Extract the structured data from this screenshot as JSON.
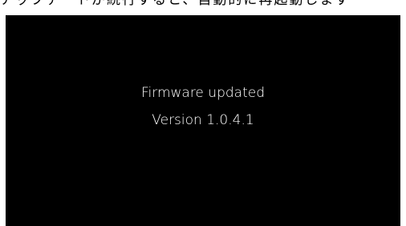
{
  "top_caption": "アップデートが続行すると、自動的に再起動します",
  "screen": {
    "title": "Firmware updated",
    "version": "Version 1.0.4.1"
  },
  "colors": {
    "screen_background": "#000000",
    "text": "#ffffff",
    "page_background": "#ffffff"
  }
}
